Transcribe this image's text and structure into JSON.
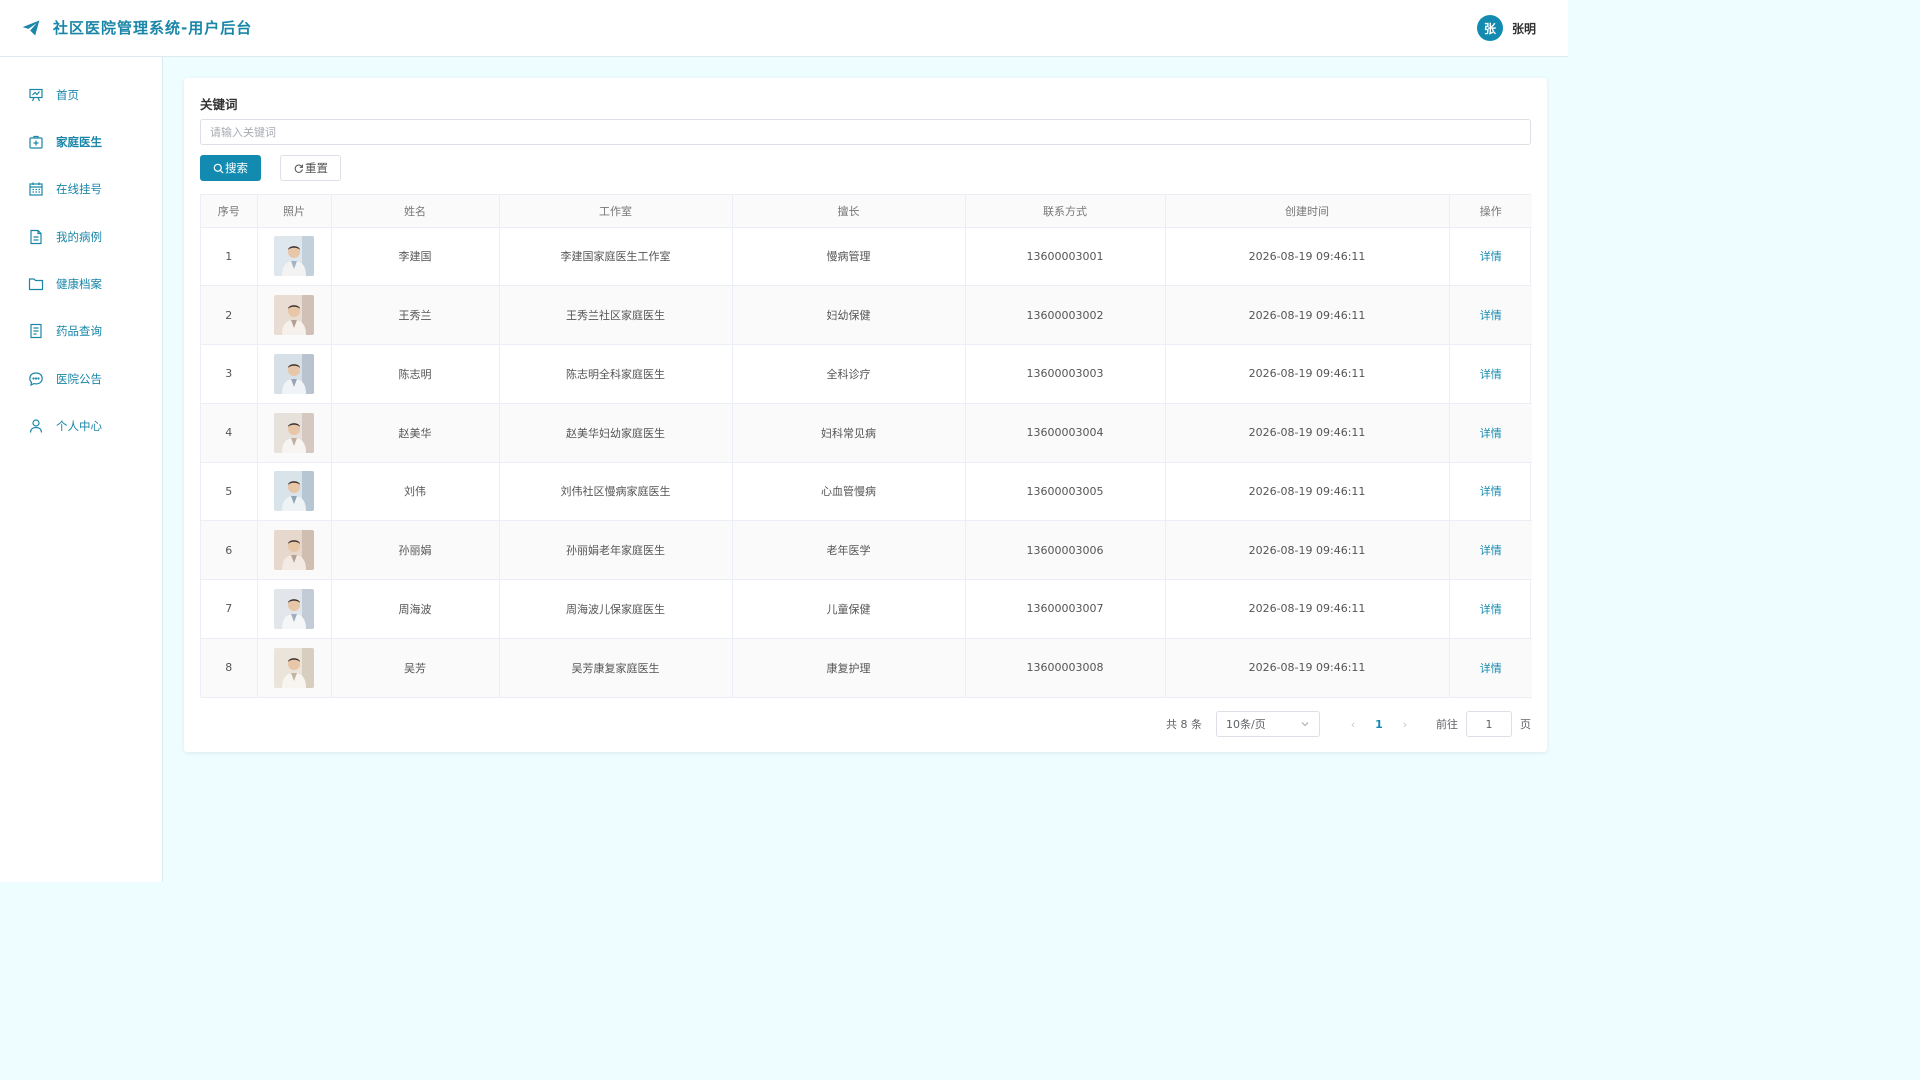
{
  "header": {
    "title": "社区医院管理系统-用户后台",
    "avatar_char": "张",
    "user_name": "张明"
  },
  "sidebar": {
    "items": [
      {
        "label": "首页",
        "icon": "chart-board-icon"
      },
      {
        "label": "家庭医生",
        "icon": "medical-kit-icon",
        "active": true
      },
      {
        "label": "在线挂号",
        "icon": "calendar-icon"
      },
      {
        "label": "我的病例",
        "icon": "document-icon"
      },
      {
        "label": "健康档案",
        "icon": "folder-icon"
      },
      {
        "label": "药品查询",
        "icon": "list-doc-icon"
      },
      {
        "label": "医院公告",
        "icon": "chat-bubble-icon"
      },
      {
        "label": "个人中心",
        "icon": "user-icon"
      }
    ]
  },
  "search": {
    "label": "关键词",
    "placeholder": "请输入关键词",
    "search_label": "搜索",
    "reset_label": "重置"
  },
  "table": {
    "headers": [
      "序号",
      "照片",
      "姓名",
      "工作室",
      "擅长",
      "联系方式",
      "创建时间",
      "操作"
    ],
    "rows": [
      {
        "no": "1",
        "name": "李建国",
        "studio": "李建国家庭医生工作室",
        "specialty": "慢病管理",
        "phone": "13600003001",
        "created": "2026-08-19 09:46:11",
        "action": "详情"
      },
      {
        "no": "2",
        "name": "王秀兰",
        "studio": "王秀兰社区家庭医生",
        "specialty": "妇幼保健",
        "phone": "13600003002",
        "created": "2026-08-19 09:46:11",
        "action": "详情"
      },
      {
        "no": "3",
        "name": "陈志明",
        "studio": "陈志明全科家庭医生",
        "specialty": "全科诊疗",
        "phone": "13600003003",
        "created": "2026-08-19 09:46:11",
        "action": "详情"
      },
      {
        "no": "4",
        "name": "赵美华",
        "studio": "赵美华妇幼家庭医生",
        "specialty": "妇科常见病",
        "phone": "13600003004",
        "created": "2026-08-19 09:46:11",
        "action": "详情"
      },
      {
        "no": "5",
        "name": "刘伟",
        "studio": "刘伟社区慢病家庭医生",
        "specialty": "心血管慢病",
        "phone": "13600003005",
        "created": "2026-08-19 09:46:11",
        "action": "详情"
      },
      {
        "no": "6",
        "name": "孙丽娟",
        "studio": "孙丽娟老年家庭医生",
        "specialty": "老年医学",
        "phone": "13600003006",
        "created": "2026-08-19 09:46:11",
        "action": "详情"
      },
      {
        "no": "7",
        "name": "周海波",
        "studio": "周海波儿保家庭医生",
        "specialty": "儿童保健",
        "phone": "13600003007",
        "created": "2026-08-19 09:46:11",
        "action": "详情"
      },
      {
        "no": "8",
        "name": "吴芳",
        "studio": "吴芳康复家庭医生",
        "specialty": "康复护理",
        "phone": "13600003008",
        "created": "2026-08-19 09:46:11",
        "action": "详情"
      }
    ]
  },
  "pagination": {
    "total": "共 8 条",
    "page_size": "10条/页",
    "current_page": "1",
    "goto_label": "前往",
    "goto_value": "1",
    "page_suffix": "页"
  },
  "colors": {
    "accent": "#138bb0",
    "background": "#eefdff"
  }
}
